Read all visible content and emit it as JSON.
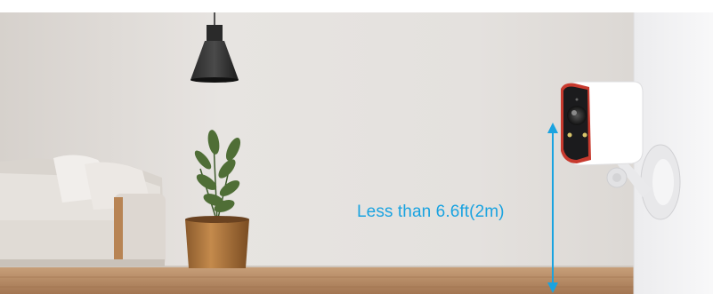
{
  "measurement": {
    "label": "Less than 6.6ft(2m)",
    "color": "#1aa3e0"
  },
  "colors": {
    "wall": "#e4e0dc",
    "floor": "#b58c62",
    "side_wall": "#f3f3f4",
    "camera_body": "#ffffff",
    "camera_accent": "#c73a2e"
  },
  "icons": {
    "pendant_lamp": "pendant-lamp-icon",
    "plant": "potted-plant-icon",
    "sofa": "sofa-icon",
    "camera": "security-camera-icon",
    "height_arrow": "double-arrow-icon"
  }
}
